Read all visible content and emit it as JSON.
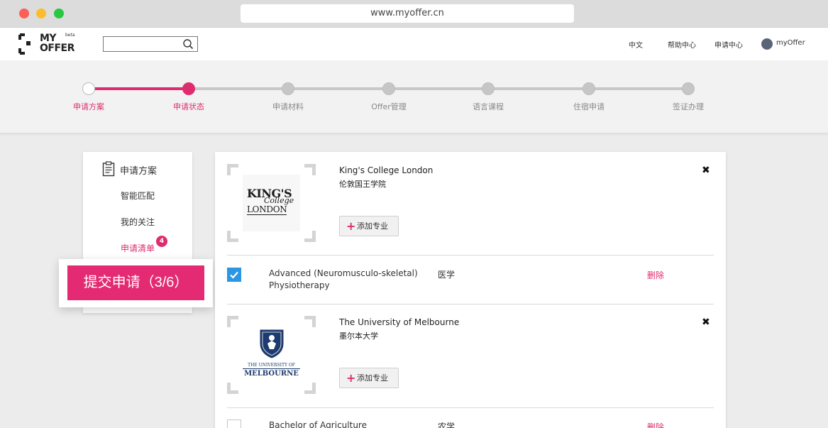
{
  "browser": {
    "url": "www.myoffer.cn"
  },
  "header": {
    "logo_text_top": "MY",
    "logo_text_bottom": "OFFER",
    "logo_beta": "beta",
    "search_placeholder": "",
    "nav": [
      "中文",
      "帮助中心",
      "申请中心"
    ],
    "user_name": "myOffer"
  },
  "stepper": {
    "steps": [
      "申请方案",
      "申请状态",
      "申请材料",
      "Offer管理",
      "语言课程",
      "住宿申请",
      "签证办理"
    ],
    "active_index": 1
  },
  "sidebar": {
    "title": "申请方案",
    "items": [
      "智能匹配",
      "我的关注",
      "申请清单"
    ],
    "active_item": "申请清单",
    "badge_count": "4",
    "submit_label": "提交申请（3/6）"
  },
  "universities": [
    {
      "name_en": "King's College London",
      "name_cn": "伦敦国王学院",
      "logo_line1": "KING'S",
      "logo_line2": "College",
      "logo_line3": "LONDON",
      "add_label": "添加专业",
      "program": {
        "name": "Advanced (Neuromusculo-skeletal) Physiotherapy",
        "field": "医学",
        "delete_label": "删除",
        "checked": true
      }
    },
    {
      "name_en": "The University of Melbourne",
      "name_cn": "墨尔本大学",
      "logo_line1": "THE UNIVERSITY OF",
      "logo_line2": "MELBOURNE",
      "add_label": "添加专业",
      "program": {
        "name": "Bachelor of Agriculture",
        "field": "农学",
        "delete_label": "删除",
        "checked": false
      }
    }
  ],
  "colors": {
    "accent": "#de2c6e",
    "check": "#2b96e4"
  }
}
